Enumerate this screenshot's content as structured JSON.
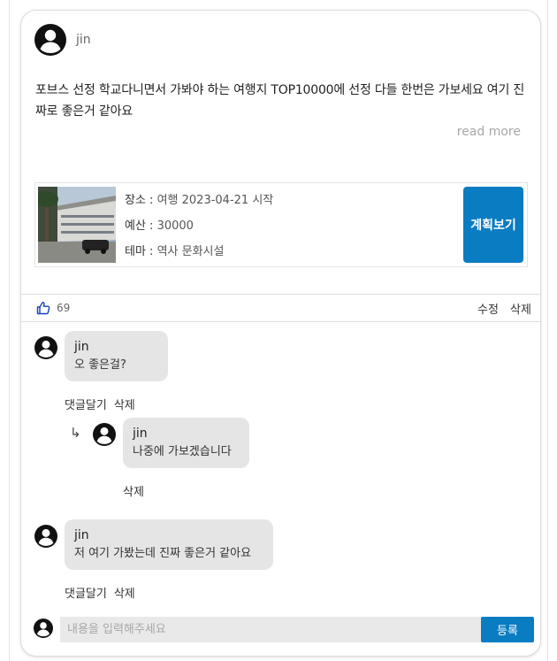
{
  "post": {
    "author": "jin",
    "content": "포브스 선정 학교다니면서 가봐야 하는 여행지 TOP10000에 선정 다들 한번은 가보세요 여기 진짜로 좋은거 같아요",
    "read_more": "read more"
  },
  "plan": {
    "place_label": "장소 : ",
    "place_value": "여행 2023-04-21 시작",
    "budget_label": "예산 : ",
    "budget_value": "30000",
    "theme_label": "테마 : ",
    "theme_value": "역사 문화시설",
    "view_button": "계획보기"
  },
  "actions": {
    "like_count": "69",
    "edit": "수정",
    "delete": "삭제"
  },
  "comments": [
    {
      "author": "jin",
      "text": "오 좋은걸?",
      "reply_label": "댓글달기",
      "delete_label": "삭제",
      "replies": [
        {
          "author": "jin",
          "text": "나중에 가보겠습니다",
          "delete_label": "삭제"
        }
      ]
    },
    {
      "author": "jin",
      "text": "저 여기 가봤는데 진짜 좋은거 같아요",
      "reply_label": "댓글달기",
      "delete_label": "삭제"
    }
  ],
  "comment_input": {
    "placeholder": "내용을 입력해주세요",
    "value": "",
    "submit": "등록"
  },
  "colors": {
    "accent": "#0a7cc2",
    "bubble": "#e5e5e5",
    "like_icon": "#1a3fbf"
  },
  "icons": {
    "avatar": "user-circle-icon",
    "like": "thumbs-up-icon",
    "reply_arrow": "reply-arrow-icon"
  }
}
